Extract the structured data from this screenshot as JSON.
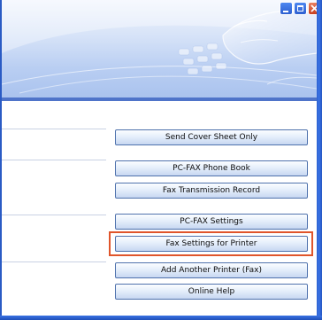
{
  "window": {
    "controls": [
      {
        "name": "minimize",
        "icon": "minimize-icon"
      },
      {
        "name": "maximize",
        "icon": "maximize-icon"
      },
      {
        "name": "close",
        "icon": "close-icon"
      }
    ]
  },
  "header": {
    "image": "hand-on-fax-machine-banner"
  },
  "buttons": {
    "send_cover_sheet_only": "Send Cover Sheet Only",
    "pc_fax_phone_book": "PC-FAX Phone Book",
    "fax_transmission_record": "Fax Transmission Record",
    "pc_fax_settings": "PC-FAX Settings",
    "fax_settings_for_printer": "Fax Settings for Printer",
    "add_another_printer_fax": "Add Another Printer (Fax)",
    "online_help": "Online Help"
  },
  "highlighted_item": "fax_settings_for_printer",
  "colors": {
    "highlight": "#e0552b",
    "button_border": "#4f72ad",
    "header_band": "#4f74c9",
    "window_frame": "#2a5bc4"
  }
}
